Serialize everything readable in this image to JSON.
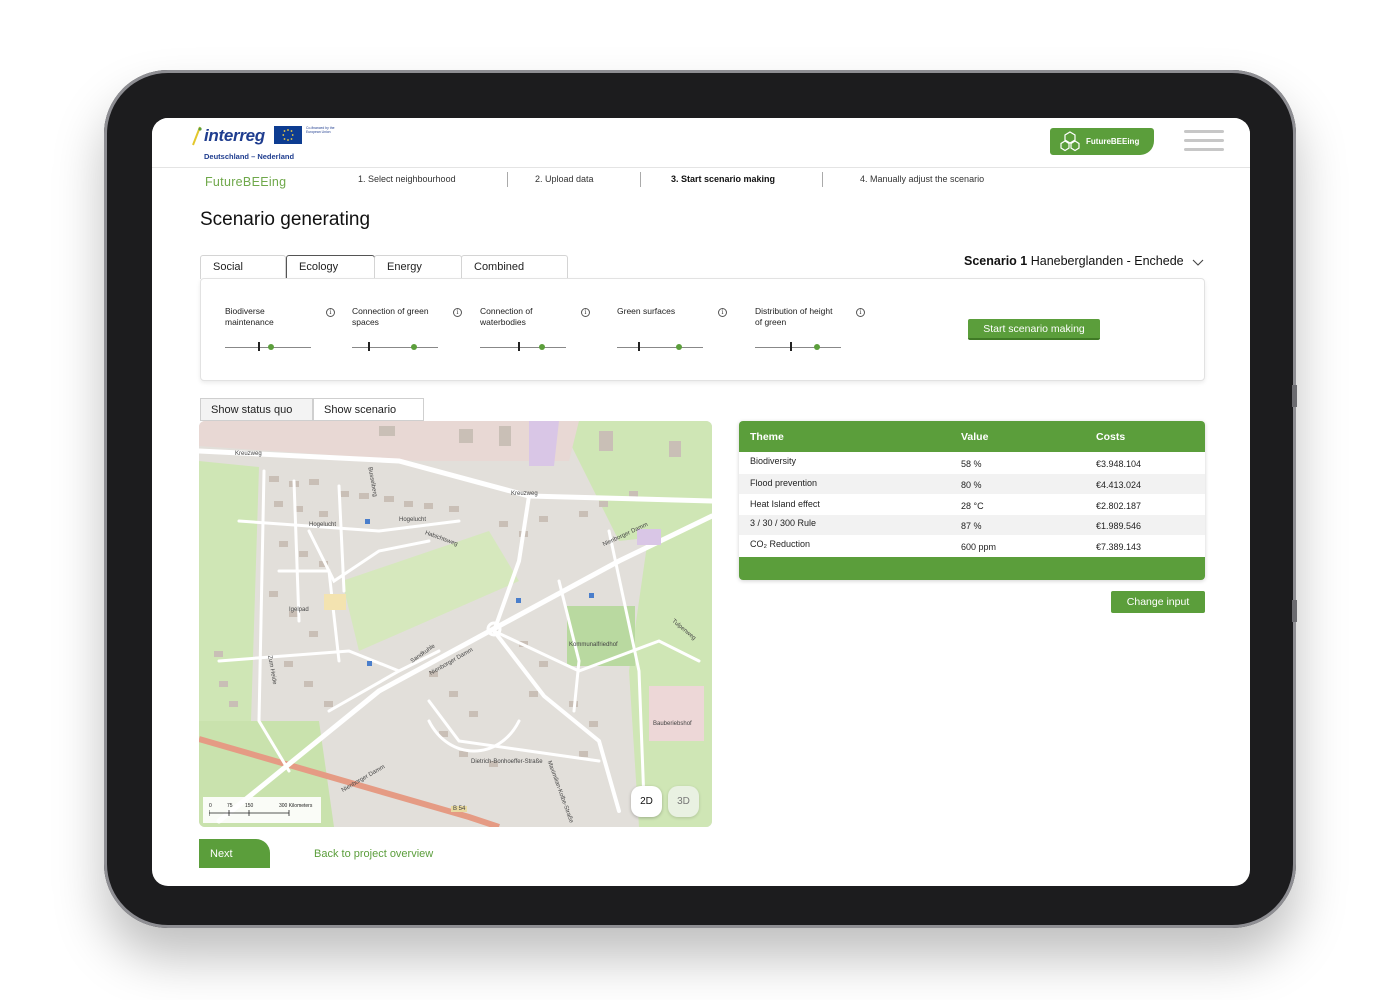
{
  "header": {
    "logo_text": "interreg",
    "logo_subtitle": "Deutschland – Nederland",
    "eu_text": "Co-financed by the European Union",
    "brand_badge": "FutureBEEing"
  },
  "stepper": {
    "brand": "FutureBEEing",
    "steps": [
      {
        "label": "1. Select neighbourhood"
      },
      {
        "label": "2. Upload data"
      },
      {
        "label": "3. Start scenario making"
      },
      {
        "label": "4. Manually adjust the scenario"
      }
    ]
  },
  "page_title": "Scenario generating",
  "tabs": [
    {
      "label": "Social"
    },
    {
      "label": "Ecology"
    },
    {
      "label": "Energy"
    },
    {
      "label": "Combined"
    }
  ],
  "scenario": {
    "name": "Scenario 1",
    "location": "Haneberglanden - Enchede"
  },
  "sliders": [
    {
      "label": "Biodiverse maintenance",
      "baseline": 0.4,
      "value": 0.53
    },
    {
      "label": "Connection of green spaces",
      "baseline": 0.2,
      "value": 0.72
    },
    {
      "label": "Connection of waterbodies",
      "baseline": 0.45,
      "value": 0.72
    },
    {
      "label": "Green surfaces",
      "baseline": 0.26,
      "value": 0.72
    },
    {
      "label": "Distribution of height of green",
      "baseline": 0.42,
      "value": 0.72
    }
  ],
  "start_button": "Start scenario making",
  "map_toggle": {
    "status_quo": "Show status quo",
    "scenario": "Show scenario"
  },
  "map": {
    "streets": [
      "Kreuzweg",
      "Hogelucht",
      "Busselberg",
      "Habichtsweg",
      "Nienborger Damm",
      "Tulpenweg",
      "Sandkuhle",
      "Igelpad",
      "Zum Heide",
      "Dietrich-Bonhoeffer-Straße",
      "Kommunalfriedhof",
      "Bauberiebshof",
      "B 54",
      "Maximilian-Kolbe-Straße"
    ],
    "scale_ticks": [
      "0",
      "75",
      "150",
      "300 Kilometers"
    ],
    "view_2d": "2D",
    "view_3d": "3D"
  },
  "results": {
    "headers": {
      "theme": "Theme",
      "value": "Value",
      "costs": "Costs"
    },
    "rows": [
      {
        "theme": "Biodiversity",
        "value": "58 %",
        "costs": "€3.948.104"
      },
      {
        "theme": "Flood prevention",
        "value": "80 %",
        "costs": "€4.413.024"
      },
      {
        "theme": "Heat Island effect",
        "value": "28 °C",
        "costs": "€2.802.187"
      },
      {
        "theme": "3 / 30 / 300 Rule",
        "value": "87 %",
        "costs": "€1.989.546"
      },
      {
        "theme": "CO₂ Reduction",
        "value": "600 ppm",
        "costs": "€7.389.143"
      }
    ]
  },
  "change_input": "Change input",
  "footer": {
    "next": "Next",
    "back": "Back to project overview"
  },
  "colors": {
    "accent": "#5b9e3b",
    "accent_light": "#6fa84a",
    "interreg_blue": "#1f3d8f"
  }
}
